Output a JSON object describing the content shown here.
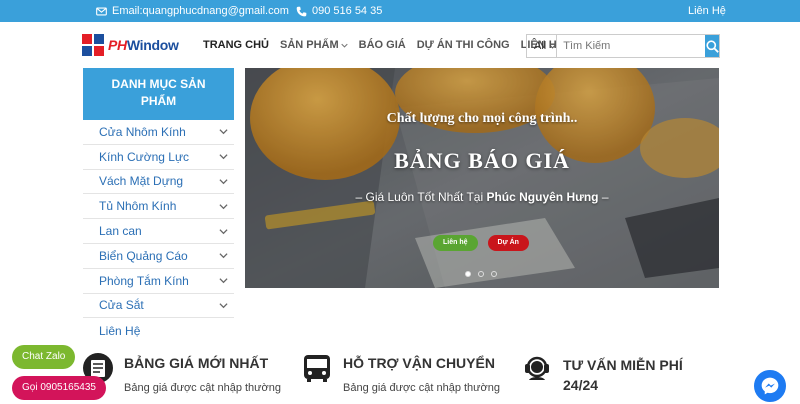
{
  "topbar": {
    "email": "Email:quangphucdnang@gmail.com",
    "phone": "090 516 54 35",
    "contact": "Liên Hệ"
  },
  "header": {
    "logo_ph": "PH",
    "logo_rest": "Window",
    "nav": [
      "TRANG CHỦ",
      "SẢN PHẨM",
      "BÁO GIÁ",
      "DỰ ÁN THI CÔNG",
      "LIÊN HỆ"
    ],
    "search": {
      "category": "All",
      "placeholder": "Tìm Kiếm"
    }
  },
  "sidebar": {
    "title": "DANH MỤC SẢN PHẨM",
    "items": [
      {
        "label": "Cửa Nhôm Kính",
        "expandable": true
      },
      {
        "label": "Kính Cường Lực",
        "expandable": true
      },
      {
        "label": "Vách Mặt Dựng",
        "expandable": true
      },
      {
        "label": "Tủ Nhôm Kính",
        "expandable": true
      },
      {
        "label": "Lan can",
        "expandable": true
      },
      {
        "label": "Biển Quảng Cáo",
        "expandable": true
      },
      {
        "label": "Phòng Tắm Kính",
        "expandable": true
      },
      {
        "label": "Cửa Sắt",
        "expandable": true
      },
      {
        "label": "Liên Hệ",
        "expandable": false
      }
    ]
  },
  "banner": {
    "line1": "Chất lượng cho mọi công trình..",
    "line2": "BẢNG BÁO GIÁ",
    "line3_prefix": "– Giá Luôn Tốt Nhất Tại ",
    "line3_brand": "Phúc Nguyên Hưng",
    "line3_suffix": " –",
    "btn_contact": "Liên hệ",
    "btn_project": "Dự Án",
    "slide_count": 3,
    "active_slide": 1
  },
  "features": [
    {
      "title": "BẢNG GIÁ MỚI NHẤT",
      "desc": "Bảng giá được cật nhập thường",
      "icon": "price-list-icon"
    },
    {
      "title": "HỖ TRỢ VẬN CHUYỂN",
      "desc": "Bảng giá được cật nhập thường",
      "icon": "bus-icon"
    },
    {
      "title": "TƯ VẤN MIỄN PHÍ",
      "title2": "24/24",
      "desc": "",
      "icon": "support-agent-icon"
    }
  ],
  "floating": {
    "zalo": "Chat Zalo",
    "call": "Gọi 0905165435"
  },
  "colors": {
    "primary": "#3aa0da",
    "zalo": "#7cb82f",
    "call": "#d3145a",
    "btn_green": "#5aa532",
    "btn_red": "#c9151b",
    "messenger": "#1e7bf2"
  }
}
